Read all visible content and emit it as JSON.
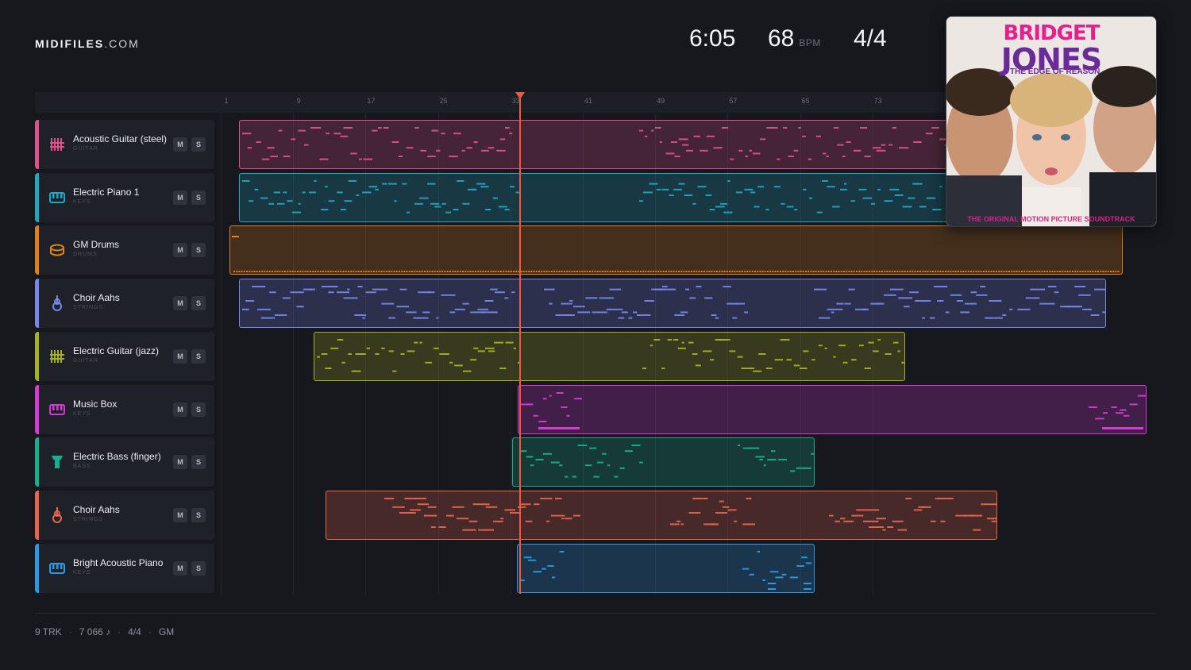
{
  "brand": {
    "name": "MIDIFILES",
    "suffix": ".COM"
  },
  "stats": {
    "duration": "6:05",
    "bpm": "68",
    "bpm_unit": "BPM",
    "time_signature": "4/4"
  },
  "ruler": {
    "ticks": [
      "1",
      "9",
      "17",
      "25",
      "33",
      "41",
      "49",
      "57",
      "65",
      "73"
    ]
  },
  "tracks": [
    {
      "name": "Acoustic Guitar (steel)",
      "category": "GUITAR",
      "color": "#e0508a",
      "icon": "guitar-icon",
      "mute": "M",
      "solo": "S"
    },
    {
      "name": "Electric Piano 1",
      "category": "KEYS",
      "color": "#1fa7c4",
      "icon": "piano-icon",
      "mute": "M",
      "solo": "S"
    },
    {
      "name": "GM Drums",
      "category": "DRUMS",
      "color": "#e0801a",
      "icon": "drum-icon",
      "mute": "M",
      "solo": "S"
    },
    {
      "name": "Choir Aahs",
      "category": "STRINGS",
      "color": "#7786e8",
      "icon": "violin-icon",
      "mute": "M",
      "solo": "S"
    },
    {
      "name": "Electric Guitar (jazz)",
      "category": "GUITAR",
      "color": "#a5b21d",
      "icon": "guitar-icon",
      "mute": "M",
      "solo": "S"
    },
    {
      "name": "Music Box",
      "category": "KEYS",
      "color": "#d63ad6",
      "icon": "piano-icon",
      "mute": "M",
      "solo": "S"
    },
    {
      "name": "Electric Bass (finger)",
      "category": "BASS",
      "color": "#17b08e",
      "icon": "bass-icon",
      "mute": "M",
      "solo": "S"
    },
    {
      "name": "Choir Aahs",
      "category": "STRINGS",
      "color": "#e8654a",
      "icon": "violin-icon",
      "mute": "M",
      "solo": "S"
    },
    {
      "name": "Bright Acoustic Piano",
      "category": "KEYS",
      "color": "#2a9ae8",
      "icon": "piano-icon",
      "mute": "M",
      "solo": "S"
    }
  ],
  "album": {
    "line1": "BRIDGET",
    "line2": "JONES",
    "line3": "THE EDGE OF REASON",
    "line4": "THE ORIGINAL MOTION PICTURE SOUNDTRACK"
  },
  "footer": {
    "tracks": "9 TRK",
    "notes": "7 066 ♪",
    "signature": "4/4",
    "standard": "GM"
  }
}
